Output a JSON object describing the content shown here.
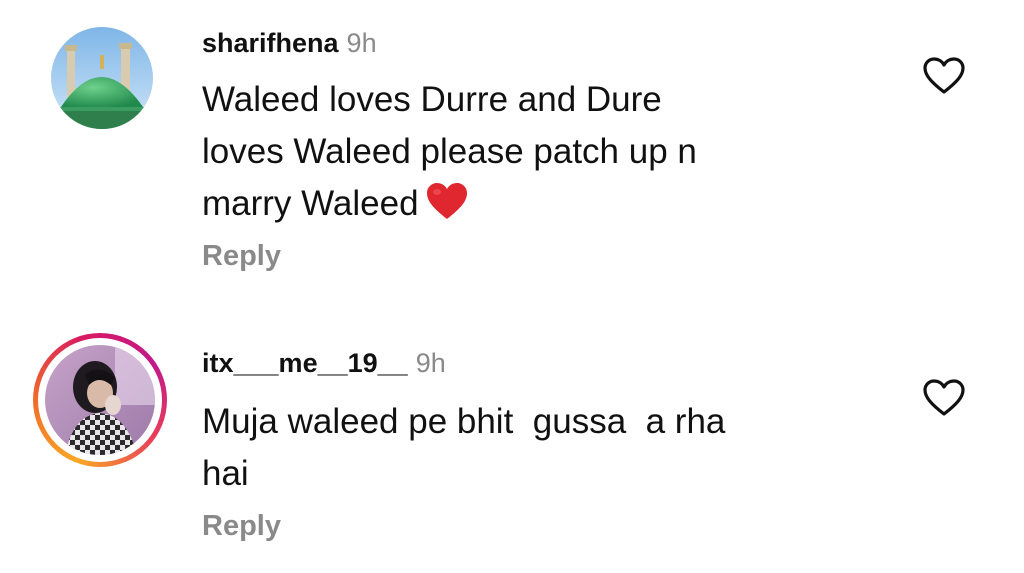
{
  "comments": [
    {
      "username": "sharifhena",
      "time": "9h",
      "text_lines": [
        "Waleed loves Durre and Dure",
        "loves Waleed please patch up n",
        "marry Waleed"
      ],
      "emoji": "❤️",
      "reply_label": "Reply",
      "avatar_icon": "green-dome-mosque-icon",
      "like_icon": "heart-outline-icon"
    },
    {
      "username": "itx___me__19__",
      "time": "9h",
      "text_lines": [
        "Muja waleed pe bhit  gussa  a rha",
        "hai"
      ],
      "reply_label": "Reply",
      "avatar_icon": "user-photo-icon",
      "story_ring": true,
      "like_icon": "heart-outline-icon"
    }
  ],
  "colors": {
    "text": "#111111",
    "muted": "#8a8a8a",
    "heart_red": "#e0262f",
    "story_ring_start": "#f9a825",
    "story_ring_end": "#c2188b"
  }
}
